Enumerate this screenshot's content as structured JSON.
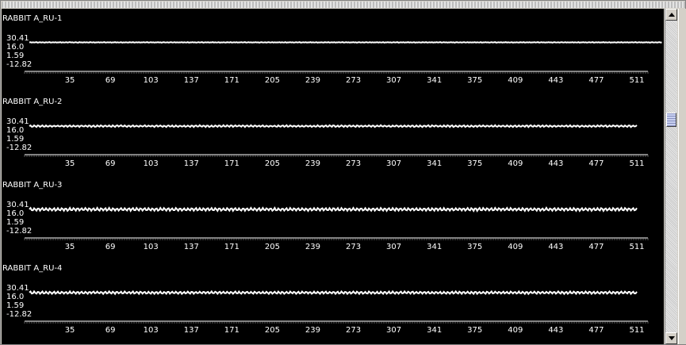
{
  "panel": {
    "colors": {
      "background": "#000000",
      "trace": "#ffffff",
      "axis": "#ffffff",
      "frame": "#d4d0c8"
    },
    "scrollbar": {
      "up_icon": "triangle-up-icon",
      "down_icon": "triangle-down-icon",
      "scroll_position": 0.3
    }
  },
  "chart_data": [
    {
      "type": "line",
      "title": "RABBIT A_RU-1",
      "y_ticks": [
        "30.41",
        "16.0",
        "1.59",
        "-12.82"
      ],
      "x_ticks": [
        "35",
        "69",
        "103",
        "137",
        "171",
        "205",
        "239",
        "273",
        "307",
        "341",
        "375",
        "409",
        "443",
        "477",
        "511"
      ],
      "xlim": [
        1,
        511
      ],
      "ylim": [
        -12.82,
        30.41
      ],
      "series": [
        {
          "values": [
            16.5,
            16.8,
            16.3,
            16.7,
            16.4,
            16.6,
            16.9,
            16.2,
            16.5,
            16.8,
            16.3,
            16.7,
            16.5,
            16.2,
            16.8,
            16.4,
            16.6,
            16.9,
            16.3,
            16.5,
            16.7,
            16.4,
            16.8,
            16.3,
            16.6,
            16.5,
            16.9,
            16.2,
            16.7,
            16.4,
            16.5,
            16.8,
            16.3,
            16.6,
            17.0,
            16.4,
            16.7,
            16.3,
            16.5,
            16.8,
            16.4,
            16.2,
            16.9,
            16.5,
            16.6,
            16.3,
            16.8,
            16.4,
            16.7,
            16.5,
            16.3,
            16.9,
            16.6,
            16.4,
            16.8,
            16.2,
            16.6,
            16.5,
            16.8,
            16.3,
            16.7,
            16.4,
            16.6,
            16.9,
            16.3,
            16.5,
            16.7,
            16.4,
            16.8,
            16.2,
            16.6,
            16.5,
            16.9,
            16.3,
            16.7,
            16.4,
            16.5,
            16.8,
            16.2,
            16.6,
            16.4,
            16.7,
            16.5,
            16.3,
            16.8,
            16.6,
            16.4,
            16.9,
            16.3,
            16.5,
            16.7,
            16.4,
            16.8,
            16.3,
            16.6,
            16.5,
            16.8,
            16.4,
            16.6,
            16.9,
            16.3,
            16.5,
            16.8,
            16.4,
            16.7,
            16.3,
            16.6,
            16.5,
            16.8,
            16.4,
            16.7,
            16.2,
            16.6,
            16.8,
            16.4,
            16.5,
            16.7,
            16.3,
            16.6,
            16.9,
            16.4,
            16.5,
            16.8,
            16.3,
            16.7,
            16.4,
            16.6,
            16.5,
            16.8,
            16.3,
            16.7,
            16.5,
            16.4,
            16.9,
            16.2,
            16.6,
            16.5,
            16.8,
            16.4,
            16.7,
            16.3,
            16.5,
            16.8,
            16.4,
            16.6,
            16.9,
            16.2,
            16.5,
            16.7,
            16.4,
            16.8,
            16.3,
            16.6,
            16.5,
            16.9,
            16.3,
            16.7,
            16.4,
            16.5,
            16.8,
            16.2,
            16.6,
            16.4,
            16.7,
            16.5,
            16.3,
            16.8,
            16.6,
            16.4,
            16.9,
            16.3,
            16.5,
            16.7,
            16.4,
            16.8,
            16.3,
            16.6,
            16.5,
            16.8,
            16.4,
            16.6,
            16.9,
            16.3,
            16.5,
            16.8,
            16.4,
            16.7,
            16.3,
            16.6,
            16.5,
            16.8,
            16.4,
            16.7,
            16.2,
            16.6,
            16.8,
            16.4,
            16.5,
            16.7,
            16.3,
            16.6,
            16.9,
            16.4,
            16.5,
            16.8,
            16.3,
            16.7,
            16.4,
            16.6,
            16.5,
            16.8,
            16.3,
            16.7,
            16.5,
            16.4,
            16.9,
            16.2,
            16.6,
            16.5,
            16.8,
            16.4,
            16.7,
            16.3,
            16.5,
            16.8,
            16.4,
            16.6,
            16.9,
            16.2,
            16.5,
            16.7,
            16.4,
            16.8,
            16.3,
            16.6,
            16.5,
            16.9,
            16.3,
            16.7,
            16.4,
            16.5,
            16.8,
            16.2,
            16.6,
            16.4,
            16.7,
            16.5,
            16.3,
            16.8,
            16.6,
            16.4,
            16.9,
            16.3,
            16.5,
            16.7,
            16.4,
            16.8,
            16.3,
            16.6,
            16.5,
            16.8,
            16.4,
            16.6,
            16.9,
            16.3,
            16.5,
            16.8,
            16.4,
            16.7,
            16.3,
            16.6,
            16.5,
            16.8,
            16.4,
            16.7,
            16.2,
            16.6,
            16.8,
            16.4,
            16.5,
            16.7,
            16.3,
            16.6,
            16.9,
            16.4,
            16.5,
            16.8,
            16.3,
            16.7,
            16.4,
            16.6,
            16.5,
            16.8,
            16.3,
            16.7,
            16.5,
            16.4,
            16.9,
            16.2,
            16.6,
            16.5,
            16.8,
            16.4,
            16.7,
            16.3,
            16.5,
            16.8,
            16.4,
            16.6,
            16.9,
            16.2,
            16.5,
            16.7,
            16.4,
            16.8,
            16.3,
            16.6,
            16.5,
            16.9,
            16.3,
            16.7,
            16.4,
            16.5,
            16.8,
            16.2,
            16.6,
            16.4,
            16.7,
            16.5,
            16.3,
            16.8,
            16.6,
            16.4,
            16.9,
            16.3,
            16.5,
            16.7,
            16.4,
            16.8,
            16.3,
            16.6,
            16.5,
            16.8,
            16.4,
            16.6,
            16.9,
            16.3,
            16.5,
            16.8,
            16.4,
            16.7,
            16.3,
            16.6,
            16.5,
            16.8,
            16.4,
            16.7,
            16.2,
            16.6,
            16.8,
            16.4,
            16.5,
            16.7,
            16.3,
            16.6,
            16.9,
            16.4,
            16.5,
            16.8,
            16.3,
            16.7,
            16.4,
            16.6,
            16.5,
            16.8,
            16.3,
            16.7,
            16.5,
            16.4,
            16.9,
            16.2,
            16.6,
            16.5,
            16.8,
            16.4,
            16.7,
            16.3,
            16.5,
            16.8,
            16.4,
            16.6,
            16.9,
            16.2,
            16.5,
            16.7,
            16.4,
            16.8,
            16.3,
            16.6,
            16.5,
            16.9,
            16.3,
            16.7,
            16.4,
            16.5,
            16.8,
            16.2,
            16.6,
            16.4,
            16.7,
            16.5,
            16.3,
            16.8,
            16.6,
            16.4,
            16.9,
            16.3,
            16.5,
            16.7,
            16.4,
            16.8,
            16.3,
            16.6,
            16.5,
            16.8,
            16.4,
            16.6,
            16.9,
            16.3,
            16.5,
            16.8,
            16.4,
            16.7,
            16.3,
            16.6,
            16.5,
            16.8,
            16.4,
            16.7,
            16.2,
            16.6,
            16.8,
            16.4,
            16.5,
            16.7,
            16.3,
            16.6,
            16.9,
            16.4,
            16.5,
            16.8,
            16.3,
            16.7,
            16.4,
            16.6,
            16.5,
            16.8,
            16.3,
            16.7,
            16.5,
            16.4,
            16.9,
            16.2,
            16.6,
            16.5,
            16.8,
            16.4,
            16.7,
            16.3,
            16.5,
            16.8,
            16.4,
            16.6,
            16.9,
            16.2,
            16.5,
            16.7,
            16.4,
            16.8,
            16.3,
            16.6,
            16.5,
            16.9,
            16.3,
            16.7,
            16.4,
            16.5,
            16.8,
            16.2,
            16.6,
            16.4,
            16.7,
            16.5,
            16.3,
            16.8,
            16.6,
            16.4,
            16.9,
            16.3,
            16.5,
            16.7,
            16.4,
            16.8,
            16.3,
            16.6,
            16.5,
            16.8,
            16.4,
            16.6,
            16.9,
            16.3,
            16.5,
            16.8,
            16.4,
            16.7,
            16.3,
            16.6,
            16.5,
            16.8,
            16.4,
            16.7,
            16.2,
            16.6,
            16.8,
            16.4,
            16.5,
            16.7,
            16.3,
            16.6,
            16.9,
            16.4,
            16.5
          ]
        }
      ]
    },
    {
      "type": "line",
      "title": "RABBIT A_RU-2",
      "y_ticks": [
        "30.41",
        "16.0",
        "1.59",
        "-12.82"
      ],
      "x_ticks": [
        "35",
        "69",
        "103",
        "137",
        "171",
        "205",
        "239",
        "273",
        "307",
        "341",
        "375",
        "409",
        "443",
        "477",
        "511"
      ],
      "xlim": [
        1,
        511
      ],
      "ylim": [
        -12.82,
        30.41
      ],
      "series": [
        {
          "values": []
        }
      ]
    },
    {
      "type": "line",
      "title": "RABBIT A_RU-3",
      "y_ticks": [
        "30.41",
        "16.0",
        "1.59",
        "-12.82"
      ],
      "x_ticks": [
        "35",
        "69",
        "103",
        "137",
        "171",
        "205",
        "239",
        "273",
        "307",
        "341",
        "375",
        "409",
        "443",
        "477",
        "511"
      ],
      "xlim": [
        1,
        511
      ],
      "ylim": [
        -12.82,
        30.41
      ],
      "series": [
        {
          "values": []
        }
      ]
    },
    {
      "type": "line",
      "title": "RABBIT A_RU-4",
      "y_ticks": [
        "30.41",
        "16.0",
        "1.59",
        "-12.82"
      ],
      "x_ticks": [
        "35",
        "69",
        "103",
        "137",
        "171",
        "205",
        "239",
        "273",
        "307",
        "341",
        "375",
        "409",
        "443",
        "477",
        "511"
      ],
      "xlim": [
        1,
        511
      ],
      "ylim": [
        -12.82,
        30.41
      ],
      "series": [
        {
          "values": []
        }
      ]
    }
  ]
}
